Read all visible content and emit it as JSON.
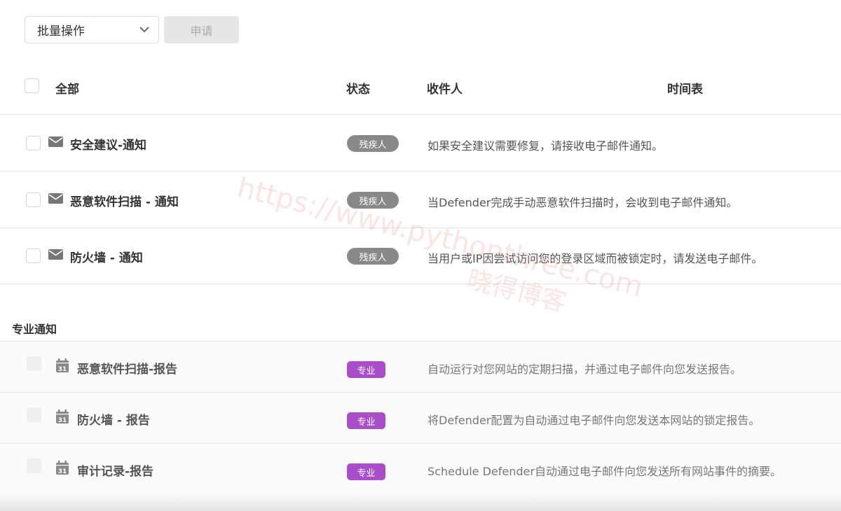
{
  "toolbar": {
    "bulk_select_value": "批量操作",
    "apply_label": "申请"
  },
  "table_header": {
    "all_label": "全部",
    "status_label": "状态",
    "recipients_label": "收件人",
    "schedule_label": "时间表"
  },
  "notifications": [
    {
      "name": "安全建议-通知",
      "status": "残疾人",
      "description": "如果安全建议需要修复，请接收电子邮件通知。",
      "icon": "envelope-icon"
    },
    {
      "name": "恶意软件扫描 - 通知",
      "status": "残疾人",
      "description": "当Defender完成手动恶意软件扫描时，会收到电子邮件通知。",
      "icon": "envelope-icon"
    },
    {
      "name": "防火墙 - 通知",
      "status": "残疾人",
      "description": "当用户或IP因尝试访问您的登录区域而被锁定时，请发送电子邮件。",
      "icon": "envelope-icon"
    }
  ],
  "pro_section": {
    "title": "专业通知",
    "items": [
      {
        "name": "恶意软件扫描-报告",
        "badge": "专业",
        "description": "自动运行对您网站的定期扫描，并通过电子邮件向您发送报告。",
        "icon": "calendar-icon",
        "icon_text": "31"
      },
      {
        "name": "防火墙 - 报告",
        "badge": "专业",
        "description": "将Defender配置为自动通过电子邮件向您发送本网站的锁定报告。",
        "icon": "calendar-icon",
        "icon_text": "31"
      },
      {
        "name": "审计记录-报告",
        "badge": "专业",
        "description": "Schedule Defender自动通过电子邮件向您发送所有网站事件的摘要。",
        "icon": "calendar-icon",
        "icon_text": "31"
      }
    ]
  },
  "watermark": {
    "line1": "https://www.pythonthree.com",
    "line2": "晓得博客"
  },
  "colors": {
    "status_badge": "#888888",
    "pro_badge": "#a94ec8",
    "apply_disabled_bg": "#e6e6e6"
  }
}
